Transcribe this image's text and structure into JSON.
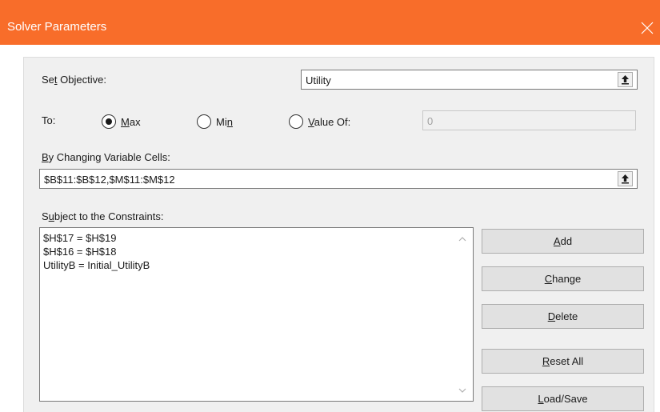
{
  "window": {
    "title": "Solver Parameters",
    "close_icon": "close-icon"
  },
  "objective": {
    "label_pre": "Se",
    "label_key": "t",
    "label_post": " Objective:",
    "value": "Utility",
    "ref_icon": "collapse-arrow-icon"
  },
  "to": {
    "label": "To:",
    "options": [
      {
        "key": "M",
        "rest": "ax",
        "selected": true
      },
      {
        "pre": "Mi",
        "key": "n",
        "selected": false
      },
      {
        "key": "V",
        "rest": "alue Of:",
        "selected": false
      }
    ],
    "value_of": "0"
  },
  "changing": {
    "label_key": "B",
    "label_rest": "y Changing Variable Cells:",
    "value": "$B$11:$B$12,$M$11:$M$12"
  },
  "constraints": {
    "label_pre": "S",
    "label_key": "u",
    "label_rest": "bject to the Constraints:",
    "items": [
      "$H$17 = $H$19",
      "$H$16 = $H$18",
      "UtilityB = Initial_UtilityB"
    ]
  },
  "buttons": {
    "add": {
      "key": "A",
      "rest": "dd"
    },
    "change": {
      "key": "C",
      "rest": "hange"
    },
    "delete": {
      "key": "D",
      "rest": "elete"
    },
    "reset": {
      "key": "R",
      "rest": "eset All"
    },
    "load": {
      "key": "L",
      "rest": "oad/Save"
    }
  },
  "colors": {
    "titlebar": "#f86d2a",
    "panel": "#f0f0f0",
    "button": "#e1e1e1"
  }
}
